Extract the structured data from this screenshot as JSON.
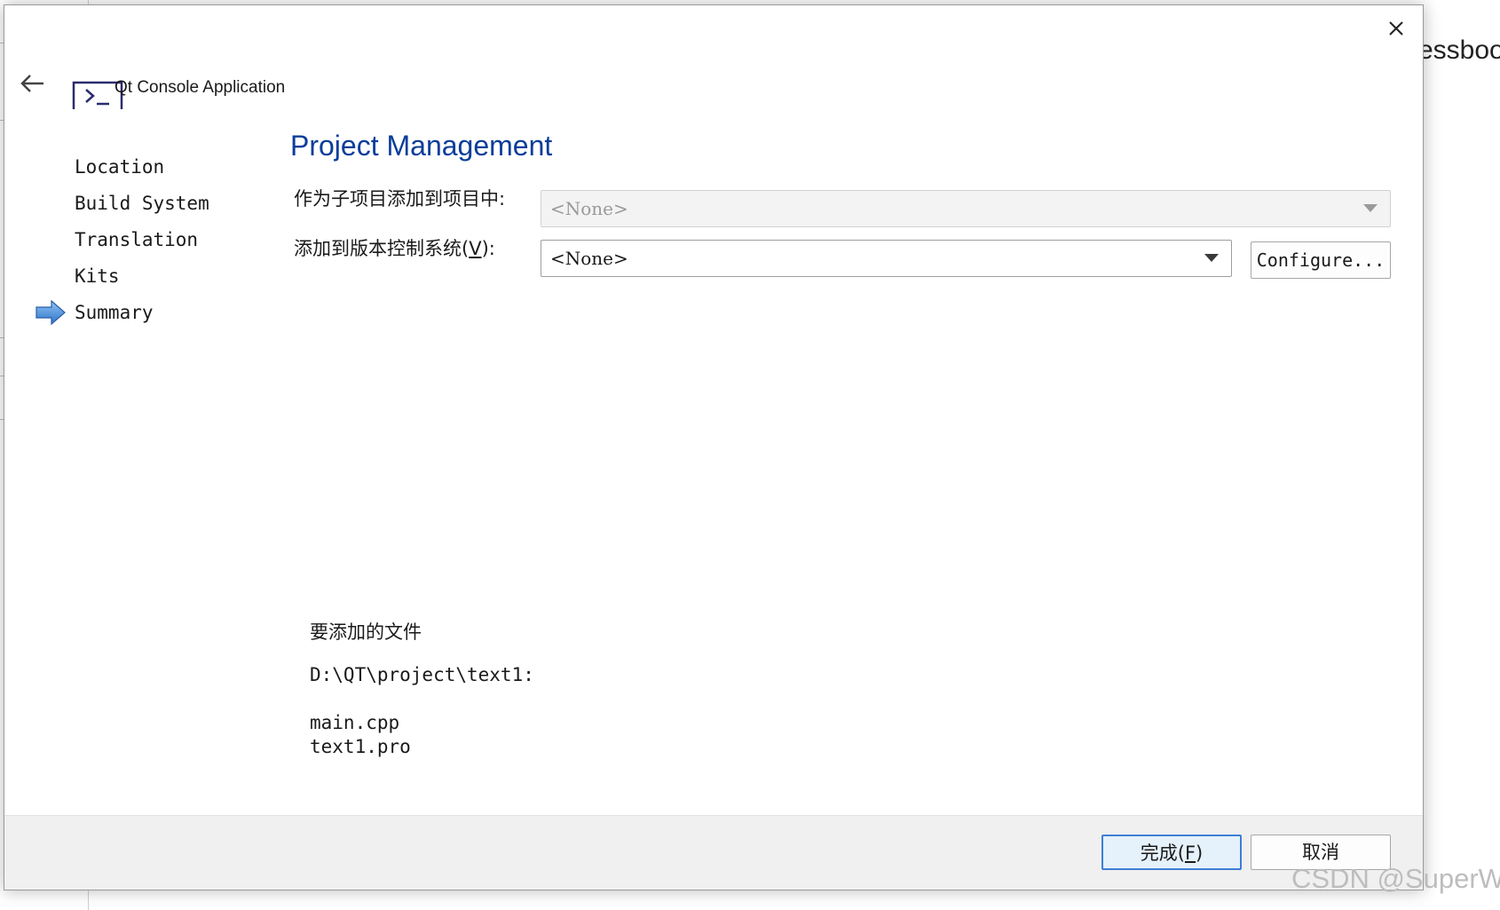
{
  "background": {
    "partial_text": "essbook",
    "watermark": "CSDN @SuperW"
  },
  "dialog": {
    "window_title": "Qt Console Application",
    "icons": {
      "back": "back-arrow-icon",
      "close": "close-icon",
      "app": "console-icon",
      "current_step": "current-step-arrow-icon"
    },
    "steps": [
      {
        "label": "Location"
      },
      {
        "label": "Build System"
      },
      {
        "label": "Translation"
      },
      {
        "label": "Kits"
      },
      {
        "label": "Summary",
        "current": true
      }
    ],
    "page_title": "Project Management",
    "form": {
      "add_as_subproject_label": "作为子项目添加到项目中:",
      "add_as_subproject_value": "<None>",
      "version_control_label": "添加到版本控制系统(",
      "version_control_mnemonic": "V",
      "version_control_label_suffix": "):",
      "version_control_value": "<None>",
      "configure_label": "Configure..."
    },
    "files": {
      "heading": "要添加的文件",
      "path": "D:\\QT\\project\\text1:",
      "items": [
        "main.cpp",
        "text1.pro"
      ]
    },
    "footer": {
      "finish_label": "完成(",
      "finish_mnemonic": "F",
      "finish_suffix": ")",
      "cancel_label": "取消"
    },
    "colors": {
      "title_blue": "#0a3d9a",
      "arrow_blue": "#2f74c9",
      "default_button_border": "#3c7fd6"
    }
  }
}
